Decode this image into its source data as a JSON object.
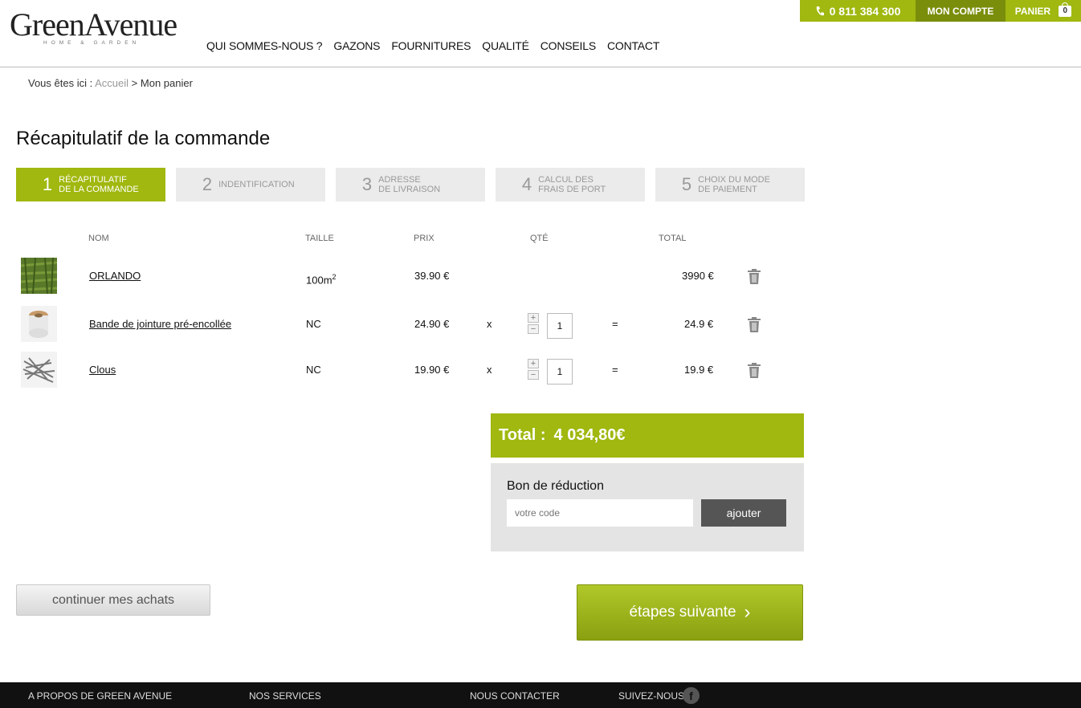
{
  "logo": {
    "main": "GreenAvenue",
    "sub": "HOME & GARDEN"
  },
  "nav": [
    "QUI SOMMES-NOUS ?",
    "GAZONS",
    "FOURNITURES",
    "QUALITÉ",
    "CONSEILS",
    "CONTACT"
  ],
  "topbar": {
    "phone": "0 811 384 300",
    "account": "MON COMPTE",
    "cart": "PANIER",
    "cart_count": "0"
  },
  "breadcrumb": {
    "prefix": "Vous êtes ici :",
    "home": "Accueil",
    "sep": ">",
    "current": "Mon panier"
  },
  "page_title": "Récapitulatif de la commande",
  "steps": [
    {
      "num": "1",
      "label": "RÉCAPITULATIF\nDE LA COMMANDE"
    },
    {
      "num": "2",
      "label": "INDENTIFICATION"
    },
    {
      "num": "3",
      "label": "ADRESSE\nDE LIVRAISON"
    },
    {
      "num": "4",
      "label": "CALCUL DES\nFRAIS DE PORT"
    },
    {
      "num": "5",
      "label": "CHOIX DU MODE\nDE PAIEMENT"
    }
  ],
  "table": {
    "headers": {
      "name": "NOM",
      "size": "TAILLE",
      "price": "PRIX",
      "qty": "QTÉ",
      "total": "TOTAL"
    },
    "rows": [
      {
        "name": "ORLANDO",
        "size": "100m",
        "size_sup": "2",
        "price": "39.90 €",
        "total": "3990 €"
      },
      {
        "name": "Bande de jointure pré-encollée",
        "size": "NC",
        "price": "24.90 €",
        "x": "x",
        "qty": "1",
        "eq": "=",
        "total": "24.9 €"
      },
      {
        "name": "Clous",
        "size": "NC",
        "price": "19.90 €",
        "x": "x",
        "qty": "1",
        "eq": "=",
        "total": "19.9 €"
      }
    ],
    "plus": "+",
    "minus": "−"
  },
  "total": {
    "label": "Total :",
    "value": "4 034,80€"
  },
  "coupon": {
    "title": "Bon de réduction",
    "placeholder": "votre code",
    "button": "ajouter"
  },
  "continue_label": "continuer mes achats",
  "next_label": "étapes suivante",
  "next_arrow": "›",
  "footer": {
    "about": "A PROPOS DE GREEN AVENUE",
    "services": "NOS SERVICES",
    "contact": "NOUS CONTACTER",
    "follow": "SUIVEZ-NOUS",
    "fb": "f"
  },
  "colors": {
    "brand_green": "#a0b80f",
    "dark_green": "#7a8e0b",
    "footer_bg": "#111111"
  }
}
